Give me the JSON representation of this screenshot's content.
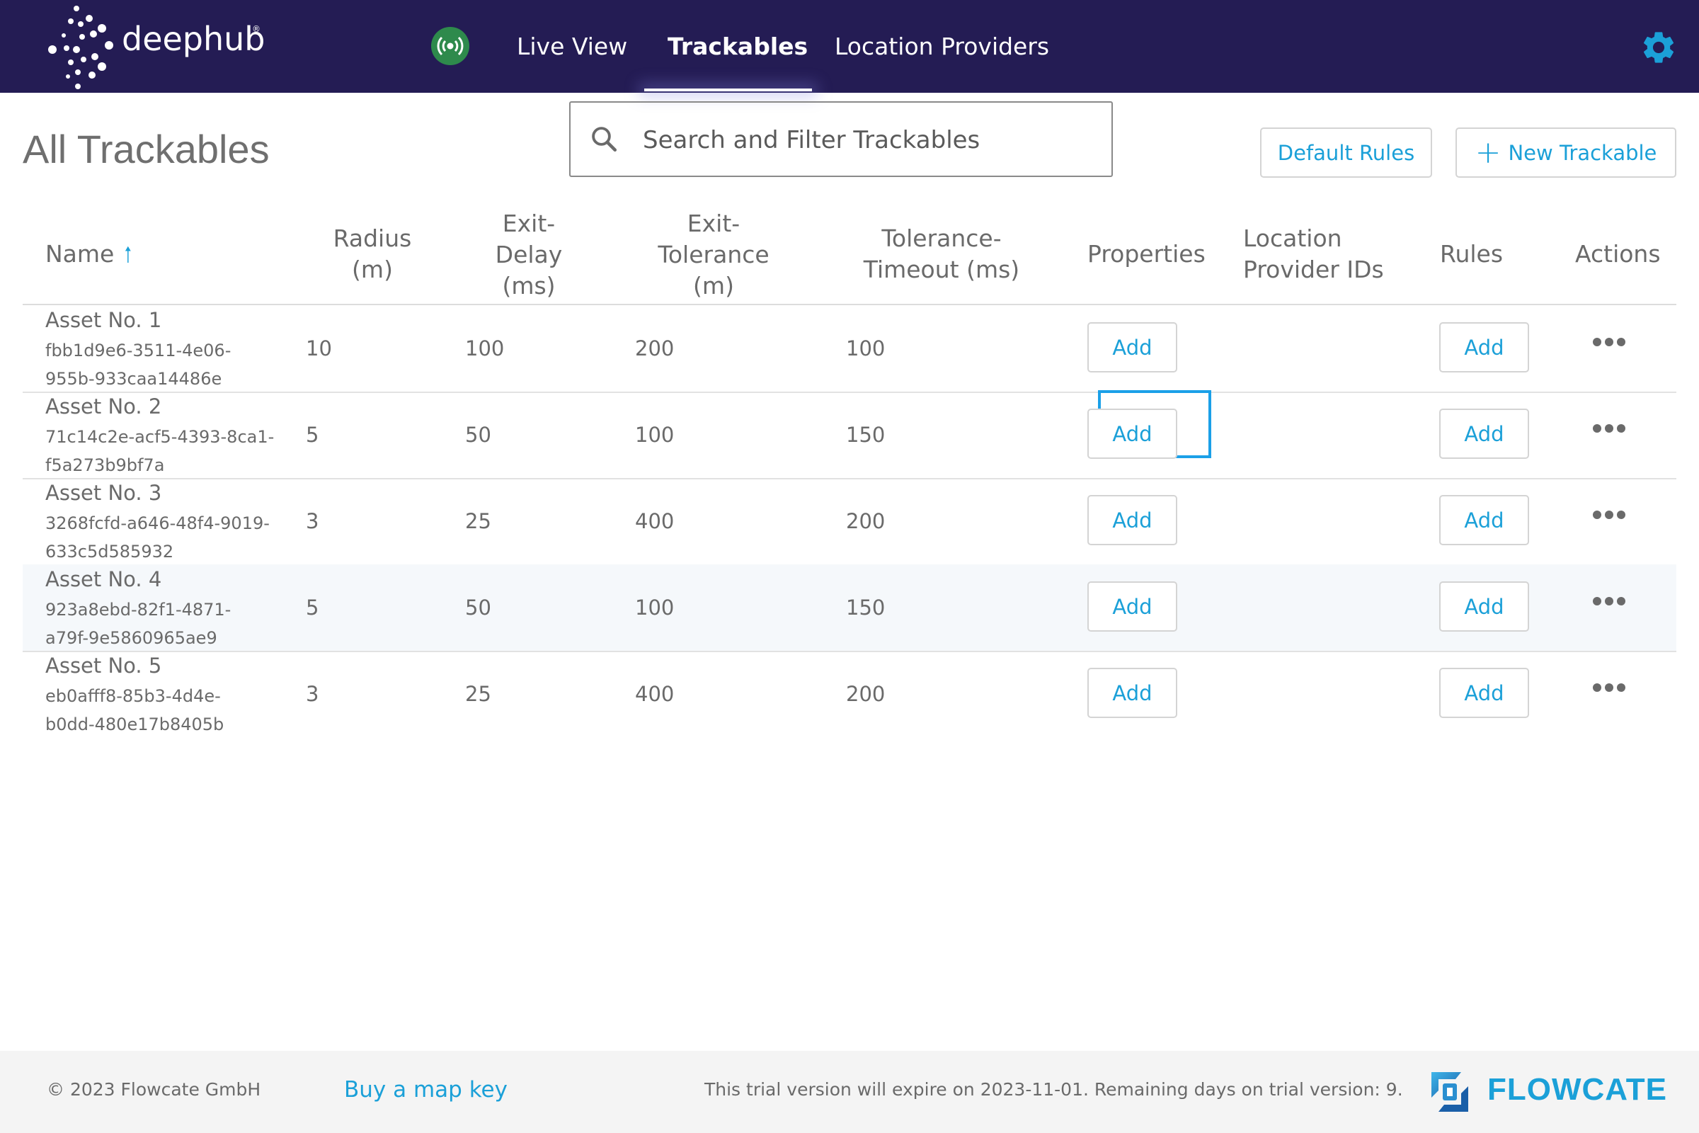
{
  "nav": {
    "brand": "deephub",
    "brand_reg": "®",
    "links": [
      "Live View",
      "Trackables",
      "Location Providers"
    ],
    "active": "Trackables"
  },
  "header": {
    "title": "All Trackables",
    "search_placeholder": "Search and Filter Trackables",
    "default_rules_label": "Default Rules",
    "new_trackable_label": "New Trackable"
  },
  "table": {
    "columns": {
      "name": "Name",
      "radius": [
        "Radius",
        "(m)"
      ],
      "exit_delay": [
        "Exit-",
        "Delay",
        "(ms)"
      ],
      "exit_tolerance": [
        "Exit-",
        "Tolerance",
        "(m)"
      ],
      "tolerance_timeout": [
        "Tolerance-",
        "Timeout (ms)"
      ],
      "properties": "Properties",
      "location_provider_ids": [
        "Location",
        "Provider IDs"
      ],
      "rules": "Rules",
      "actions": "Actions"
    },
    "add_label": "Add",
    "rows": [
      {
        "name": "Asset No. 1",
        "id": "fbb1d9e6-3511-4e06-955b-933caa14486e",
        "id_lines": [
          "fbb1d9e6-3511-4e06-",
          "955b-933caa14486e"
        ],
        "radius": "10",
        "exit_delay": "100",
        "exit_tolerance": "200",
        "tolerance_timeout": "100"
      },
      {
        "name": "Asset No. 2",
        "id": "71c14c2e-acf5-4393-8ca1-f5a273b9bf7a",
        "id_lines": [
          "71c14c2e-acf5-4393-8ca1-",
          "f5a273b9bf7a"
        ],
        "radius": "5",
        "exit_delay": "50",
        "exit_tolerance": "100",
        "tolerance_timeout": "150"
      },
      {
        "name": "Asset No. 3",
        "id": "3268fcfd-a646-48f4-9019-633c5d585932",
        "id_lines": [
          "3268fcfd-a646-48f4-9019-",
          "633c5d585932"
        ],
        "radius": "3",
        "exit_delay": "25",
        "exit_tolerance": "400",
        "tolerance_timeout": "200"
      },
      {
        "name": "Asset No. 4",
        "id": "923a8ebd-82f1-4871-a79f-9e5860965ae9",
        "id_lines": [
          "923a8ebd-82f1-4871-",
          "a79f-9e5860965ae9"
        ],
        "radius": "5",
        "exit_delay": "50",
        "exit_tolerance": "100",
        "tolerance_timeout": "150"
      },
      {
        "name": "Asset No. 5",
        "id": "eb0afff8-85b3-4d4e-b0dd-480e17b8405b",
        "id_lines": [
          "eb0afff8-85b3-4d4e-",
          "b0dd-480e17b8405b"
        ],
        "radius": "3",
        "exit_delay": "25",
        "exit_tolerance": "400",
        "tolerance_timeout": "200"
      }
    ]
  },
  "footer": {
    "copyright": "© 2023 Flowcate GmbH",
    "buy_link": "Buy a map key",
    "trial_text": "This trial version will expire on 2023-11-01. Remaining days on trial version: 9.",
    "brand": "FLOWCATE"
  },
  "colors": {
    "nav_bg": "#241c54",
    "accent": "#1ba0d8",
    "live_indicator": "#2e8a4c",
    "footer_bg": "#f4f4f4"
  }
}
